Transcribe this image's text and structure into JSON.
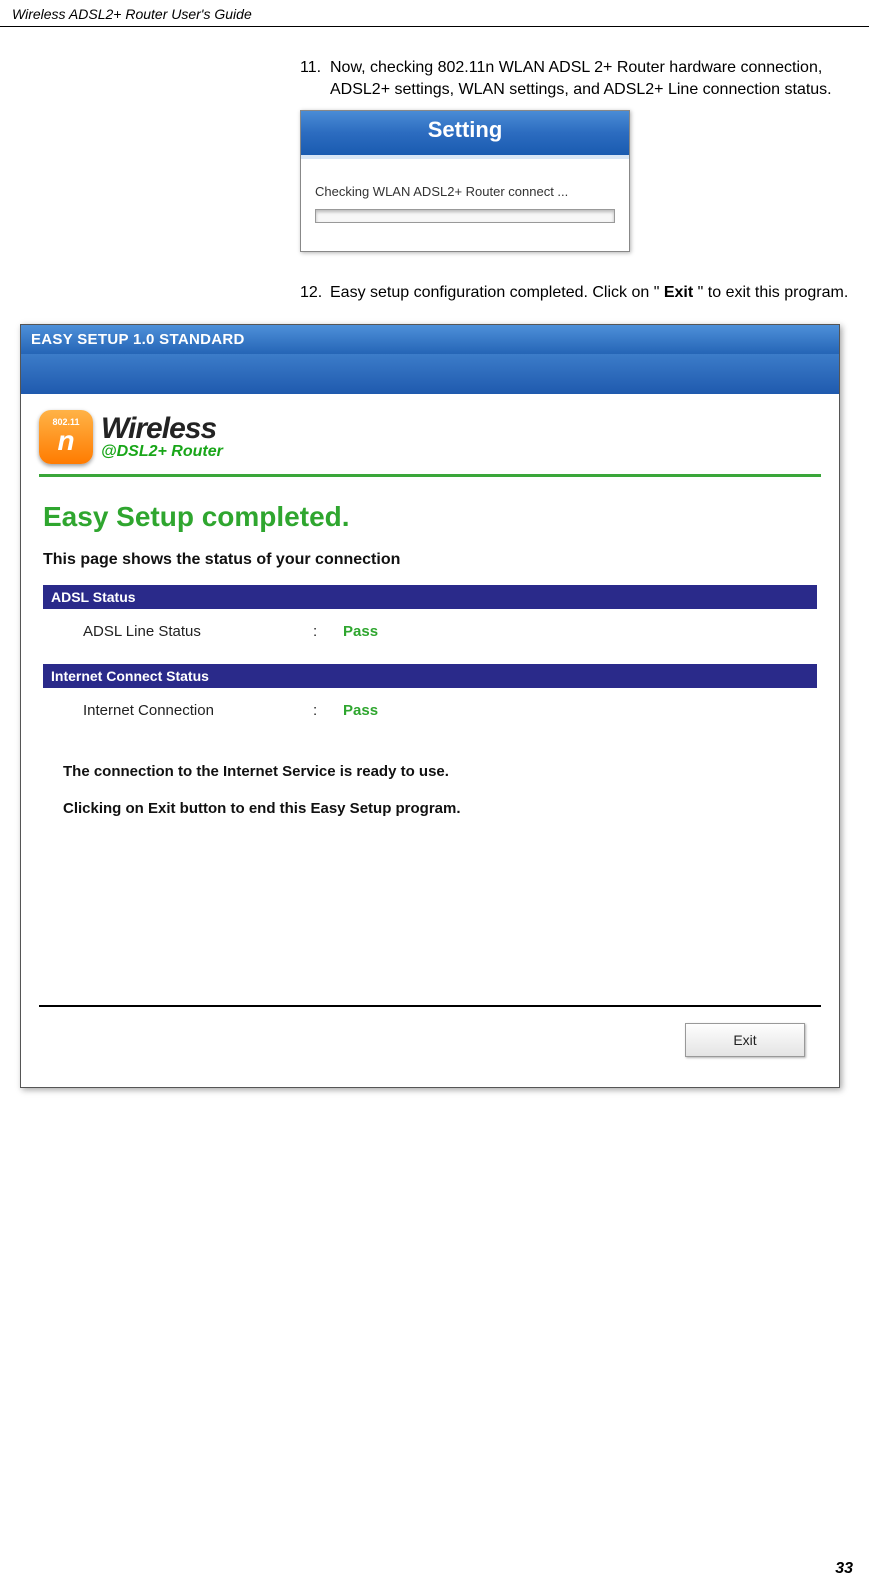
{
  "doc_header": "Wireless ADSL2+ Router User's Guide",
  "page_number": "33",
  "step11": {
    "num": "11.",
    "text_a": "Now, checking 802.11n WLAN ADSL 2+ Router hardware connection, ADSL2+ settings, WLAN settings, and ADSL2+ Line connection status."
  },
  "setting_dialog": {
    "title": "Setting",
    "body": "Checking WLAN ADSL2+ Router connect ..."
  },
  "step12": {
    "num": "12.",
    "pre": "Easy setup configuration completed. Click on \" ",
    "bold": "Exit",
    "post": " \" to exit this program."
  },
  "app": {
    "titlebar": "EASY SETUP 1.0 STANDARD",
    "logo": {
      "badge_top": "802.11",
      "badge_main": "n",
      "wireless": "Wireless",
      "sub": "@DSL2+ Router"
    },
    "heading": "Easy Setup completed.",
    "intro": "This page shows the status of your connection",
    "adsl_section": "ADSL Status",
    "adsl_row": {
      "label": "ADSL Line Status",
      "colon": ":",
      "value": "Pass"
    },
    "net_section": "Internet Connect Status",
    "net_row": {
      "label": "Internet Connection",
      "colon": ":",
      "value": "Pass"
    },
    "msg1": "The connection to the Internet Service is ready to use.",
    "msg2": "Clicking on Exit button to end this Easy Setup program.",
    "exit_label": "Exit"
  }
}
